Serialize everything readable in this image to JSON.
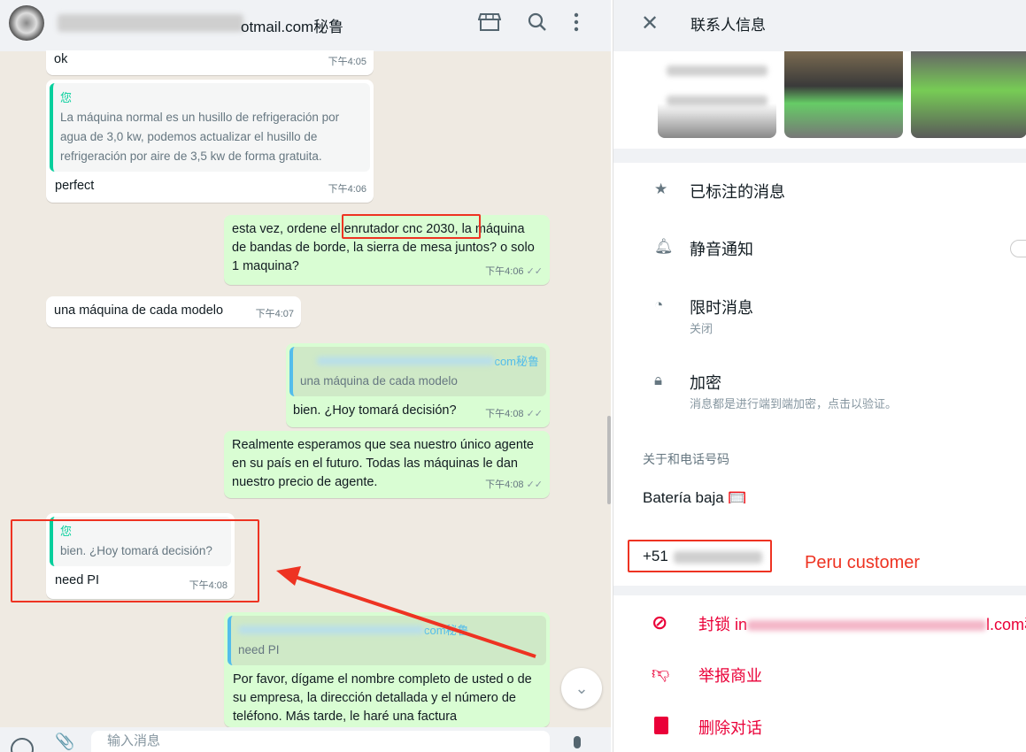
{
  "chat": {
    "header": {
      "title_visible": "otmail.com秘鲁",
      "icons": [
        "catalog-icon",
        "search-icon",
        "menu-icon"
      ]
    },
    "messages": [
      {
        "dir": "in",
        "text": "ok",
        "time": "下午4:05"
      },
      {
        "dir": "in",
        "quote_author": "您",
        "quote_text": "La máquina normal es un husillo de refrigeración por agua de 3,0 kw, podemos actualizar el husillo de refrigeración por aire de 3,5 kw de forma gratuita.",
        "text": "perfect",
        "time": "下午4:06"
      },
      {
        "dir": "out",
        "text_before": "esta vez, ordene e",
        "highlight": "l enrutador cnc 2030,",
        "text_after": " la máquina de bandas de borde, la sierra de mesa juntos? o solo 1 maquina?",
        "time": "下午4:06"
      },
      {
        "dir": "in",
        "text": "una máquina de cada modelo",
        "time": "下午4:07"
      },
      {
        "dir": "out",
        "quote_author": "com秘鲁",
        "quote_text": "una máquina de cada modelo",
        "text": "bien. ¿Hoy tomará decisión?",
        "time": "下午4:08"
      },
      {
        "dir": "out",
        "text": "Realmente esperamos que sea nuestro único agente en su país en el futuro. Todas las máquinas le dan nuestro precio de agente.",
        "time": "下午4:08"
      },
      {
        "dir": "in",
        "quote_author": "您",
        "quote_text": "bien. ¿Hoy tomará decisión?",
        "text": "need PI",
        "time": "下午4:08"
      },
      {
        "dir": "out",
        "quote_author": "com秘鲁",
        "quote_text": "need PI",
        "text": "Por favor, dígame el nombre completo de usted o de su empresa, la dirección detallada y el número de teléfono. Más tarde, le haré una factura"
      }
    ],
    "composer": {
      "placeholder": "输入消息"
    }
  },
  "contact": {
    "title": "联系人信息",
    "starred": "已标注的消息",
    "mute": "静音通知",
    "disappearing": "限时消息",
    "disappearing_sub": "关闭",
    "encryption": "加密",
    "encryption_sub": "消息都是进行端到端加密，点击以验证。",
    "about_label": "关于和电话号码",
    "about": "Batería baja 🥅",
    "phone_prefix": "+51",
    "annotation": "Peru customer",
    "block_prefix": "封锁 in",
    "block_suffix": "l.com秘",
    "report": "举报商业",
    "delete": "删除对话"
  },
  "colors": {
    "danger": "#ea0038",
    "outgoing": "#d9fdd3",
    "annotation": "#e32222"
  }
}
